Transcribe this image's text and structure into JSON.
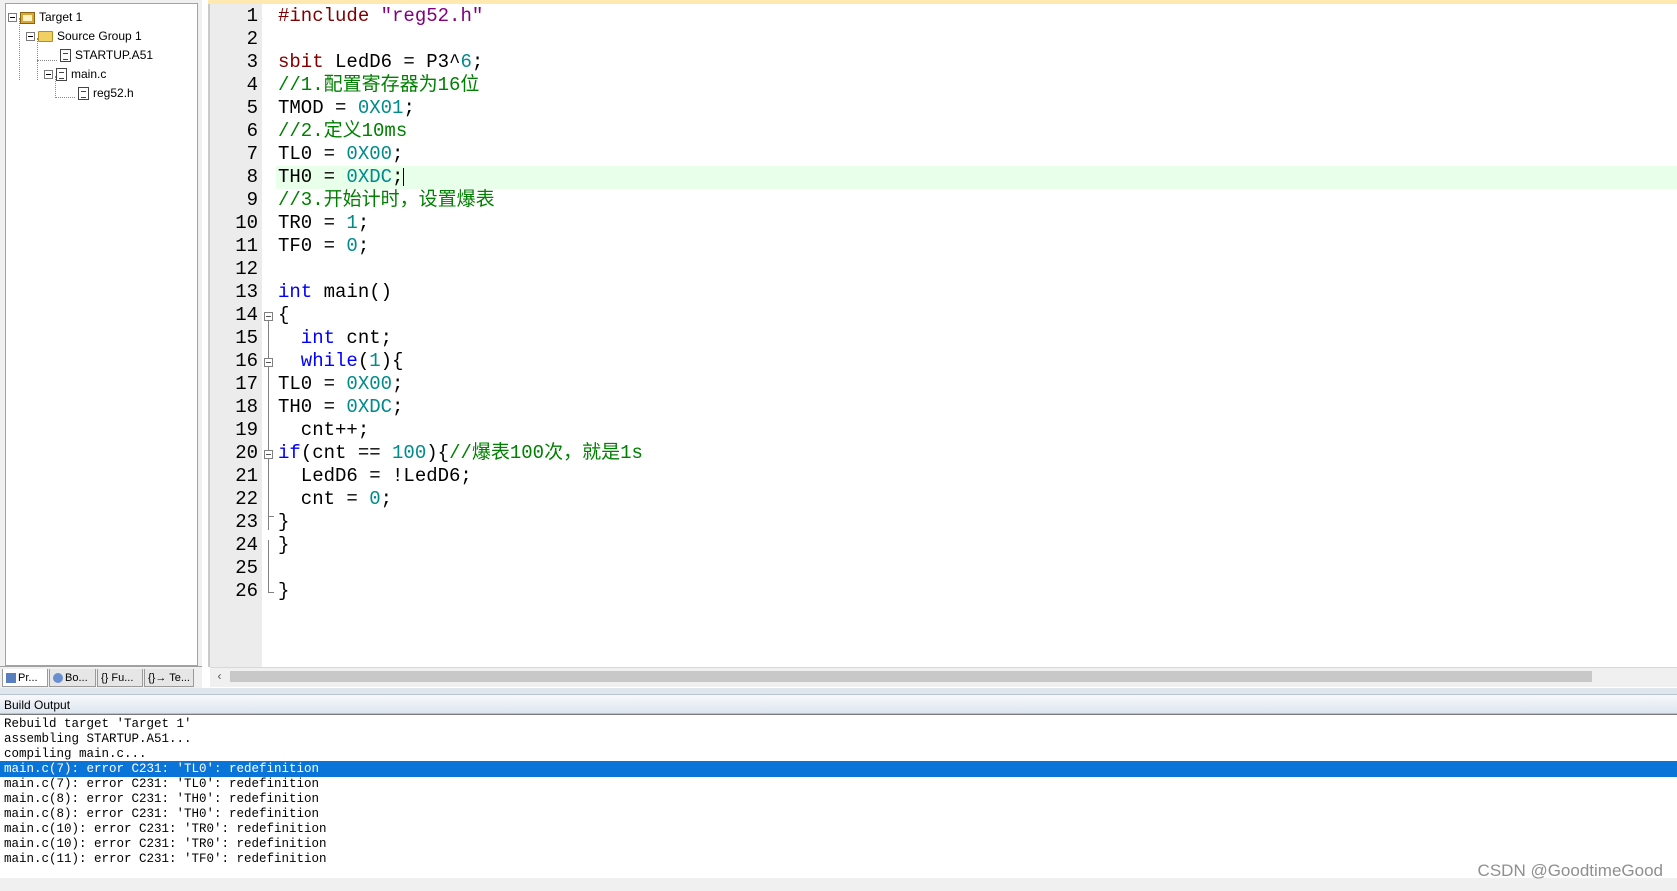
{
  "project": {
    "tree": [
      {
        "label": "Target 1",
        "icon": "target-icon"
      },
      {
        "label": "Source Group 1",
        "icon": "folder-icon"
      },
      {
        "label": "STARTUP.A51",
        "icon": "file-icon"
      },
      {
        "label": "main.c",
        "icon": "file-icon"
      },
      {
        "label": "reg52.h",
        "icon": "header-file-icon"
      }
    ],
    "tabs": [
      "Pr...",
      "Bo...",
      "{} Fu...",
      "{}→ Te..."
    ]
  },
  "editor": {
    "lines": [
      {
        "n": "1"
      },
      {
        "n": "2"
      },
      {
        "n": "3"
      },
      {
        "n": "4"
      },
      {
        "n": "5"
      },
      {
        "n": "6"
      },
      {
        "n": "7"
      },
      {
        "n": "8"
      },
      {
        "n": "9"
      },
      {
        "n": "10"
      },
      {
        "n": "11"
      },
      {
        "n": "12"
      },
      {
        "n": "13"
      },
      {
        "n": "14"
      },
      {
        "n": "15"
      },
      {
        "n": "16"
      },
      {
        "n": "17"
      },
      {
        "n": "18"
      },
      {
        "n": "19"
      },
      {
        "n": "20"
      },
      {
        "n": "21"
      },
      {
        "n": "22"
      },
      {
        "n": "23"
      },
      {
        "n": "24"
      },
      {
        "n": "25"
      },
      {
        "n": "26"
      }
    ],
    "code": {
      "l1_pp": "#include ",
      "l1_str": "\"reg52.h\"",
      "l3_kw": "sbit",
      "l3_rest": " LedD6 = P3^",
      "l3_num": "6",
      "l3_end": ";",
      "l4_com": "//1.配置寄存器为16位",
      "l5_a": "TMOD = ",
      "l5_num": "0X01",
      "l5_end": ";",
      "l6_com": "//2.定义10ms",
      "l7_a": "TL0 = ",
      "l7_num": "0X00",
      "l7_end": ";",
      "l8_a": "TH0 = ",
      "l8_num": "0XDC",
      "l8_end": ";",
      "l9_com": "//3.开始计时，设置爆表",
      "l10_a": "TR0 = ",
      "l10_num": "1",
      "l10_end": ";",
      "l11_a": "TF0 = ",
      "l11_num": "0",
      "l11_end": ";",
      "l13_kw": "int",
      "l13_rest": " main()",
      "l14": "{",
      "l15_kw": "  int",
      "l15_rest": " cnt;",
      "l16_kw": "  while",
      "l16_a": "(",
      "l16_num": "1",
      "l16_b": "){",
      "l17_a": "TL0 = ",
      "l17_num": "0X00",
      "l17_end": ";",
      "l18_a": "TH0 = ",
      "l18_num": "0XDC",
      "l18_end": ";",
      "l19": "  cnt++;",
      "l20_kw": "if",
      "l20_a": "(cnt == ",
      "l20_num": "100",
      "l20_b": "){",
      "l20_com": "//爆表100次，就是1s",
      "l21": "  LedD6 = !LedD6;",
      "l22_a": "  cnt = ",
      "l22_num": "0",
      "l22_end": ";",
      "l23": "}",
      "l24": "}",
      "l26": "}"
    }
  },
  "build": {
    "title": "Build Output",
    "lines": [
      "Rebuild target 'Target 1'",
      "assembling STARTUP.A51...",
      "compiling main.c...",
      "main.c(7): error C231: 'TL0': redefinition",
      "main.c(7): error C231: 'TL0': redefinition",
      "main.c(8): error C231: 'TH0': redefinition",
      "main.c(8): error C231: 'TH0': redefinition",
      "main.c(10): error C231: 'TR0': redefinition",
      "main.c(10): error C231: 'TR0': redefinition",
      "main.c(11): error C231: 'TF0': redefinition"
    ],
    "selected_index": 3
  },
  "watermark": "CSDN @GoodtimeGood",
  "colors": {
    "selection": "#0a74d8",
    "current_line": "#e8ffea",
    "keyword": "#0000ff",
    "number": "#008b8b",
    "comment": "#008000"
  }
}
